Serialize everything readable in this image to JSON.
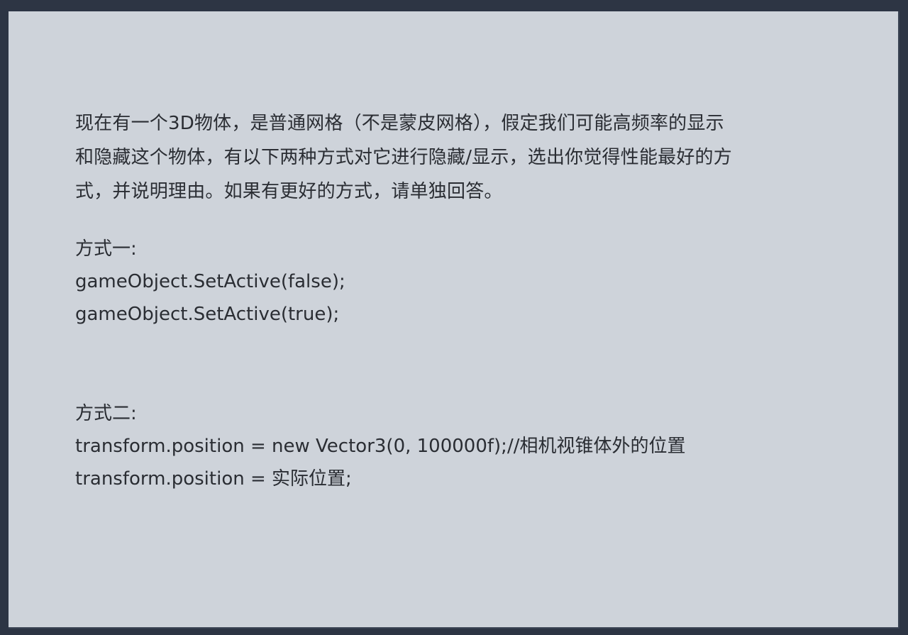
{
  "question": {
    "paragraph": [
      "现在有一个3D物体，是普通网格（不是蒙皮网格），假定我们可能高频率的显示",
      "和隐藏这个物体，有以下两种方式对它进行隐藏/显示，选出你觉得性能最好的方",
      "式，并说明理由。如果有更好的方式，请单独回答。"
    ]
  },
  "method1": {
    "heading": "方式一:",
    "lines": [
      "gameObject.SetActive(false);",
      "gameObject.SetActive(true);"
    ]
  },
  "method2": {
    "heading": "方式二:",
    "lines": [
      "transform.position = new Vector3(0, 100000f);//相机视锥体外的位置",
      "transform.position = 实际位置;"
    ]
  }
}
